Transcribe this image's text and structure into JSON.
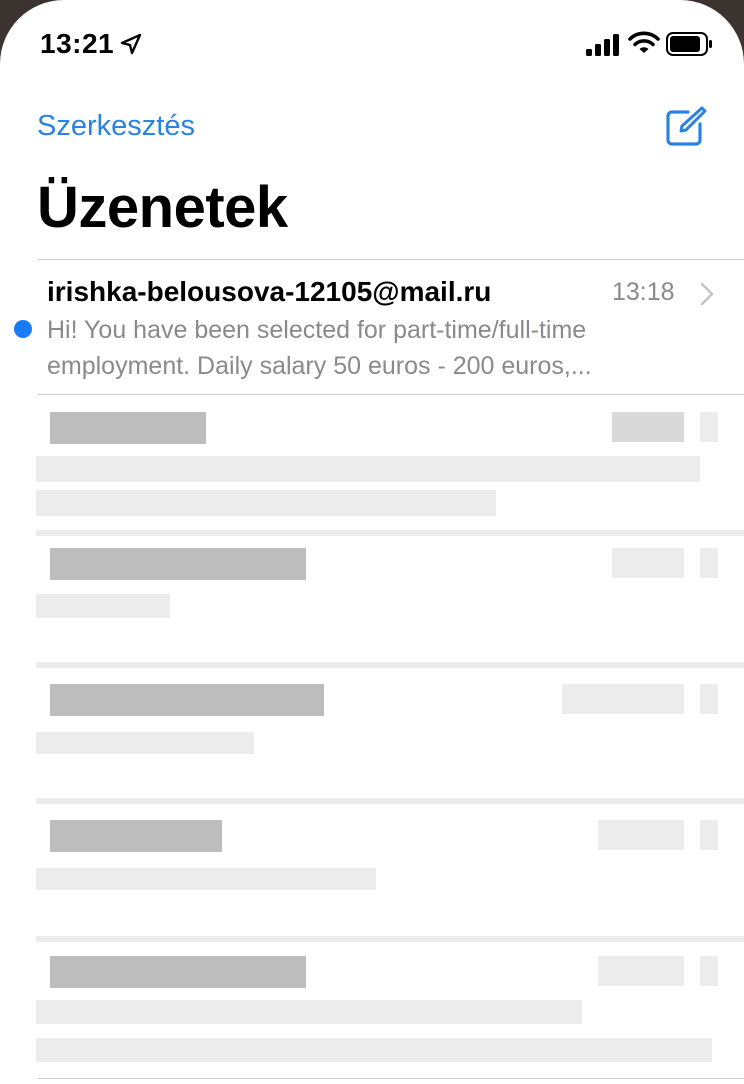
{
  "status_bar": {
    "time": "13:21"
  },
  "nav": {
    "edit_label": "Szerkesztés"
  },
  "page": {
    "title": "Üzenetek"
  },
  "messages": [
    {
      "sender": "irishka-belousova-12105@mail.ru",
      "time": "13:18",
      "preview": "Hi! You have been selected for part-time/full-time employment. Daily salary 50 euros - 200 euros,...",
      "unread": true
    }
  ],
  "colors": {
    "accent": "#2a82e4",
    "unread_dot": "#1a7cf5",
    "secondary_text": "#8a8a8e"
  }
}
